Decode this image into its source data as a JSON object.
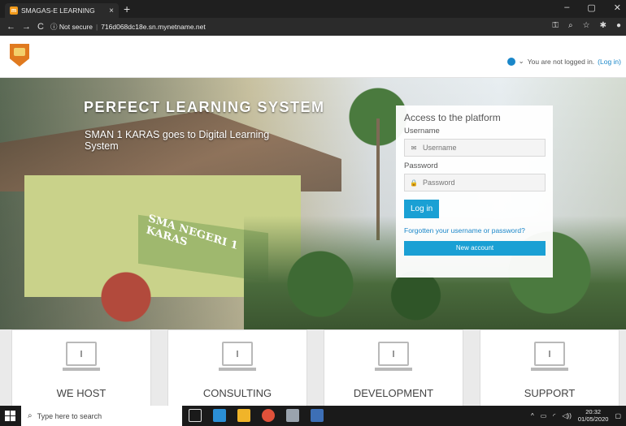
{
  "browser": {
    "tab_title": "SMAGAS-E LEARNING",
    "tab_close": "×",
    "new_tab": "+",
    "url_security": "ⓘ Not secure",
    "url": "716d068dc18e.sn.mynetname.net",
    "window_controls": [
      "–",
      "▢",
      "✕"
    ]
  },
  "header": {
    "login_status": "You are not logged in.",
    "login_link": "(Log in)"
  },
  "hero": {
    "title": "PERFECT LEARNING SYSTEM",
    "subtitle": "SMAN 1 KARAS goes to Digital Learning System",
    "sign_text": "SMA NEGERI 1 KARAS"
  },
  "login": {
    "heading": "Access to the platform",
    "username_label": "Username",
    "username_placeholder": "Username",
    "password_label": "Password",
    "password_placeholder": "Password",
    "login_button": "Log in",
    "forgot_link": "Forgotten your username or password?",
    "new_account_button": "New account"
  },
  "features": [
    {
      "label": "WE HOST"
    },
    {
      "label": "CONSULTING"
    },
    {
      "label": "DEVELOPMENT"
    },
    {
      "label": "SUPPORT"
    }
  ],
  "taskbar": {
    "search_placeholder": "Type here to search",
    "time": "20:32",
    "date": "01/05/2020"
  },
  "colors": {
    "accent": "#1aa0d4",
    "link": "#1a87c9",
    "logo": "#e07a1f"
  }
}
